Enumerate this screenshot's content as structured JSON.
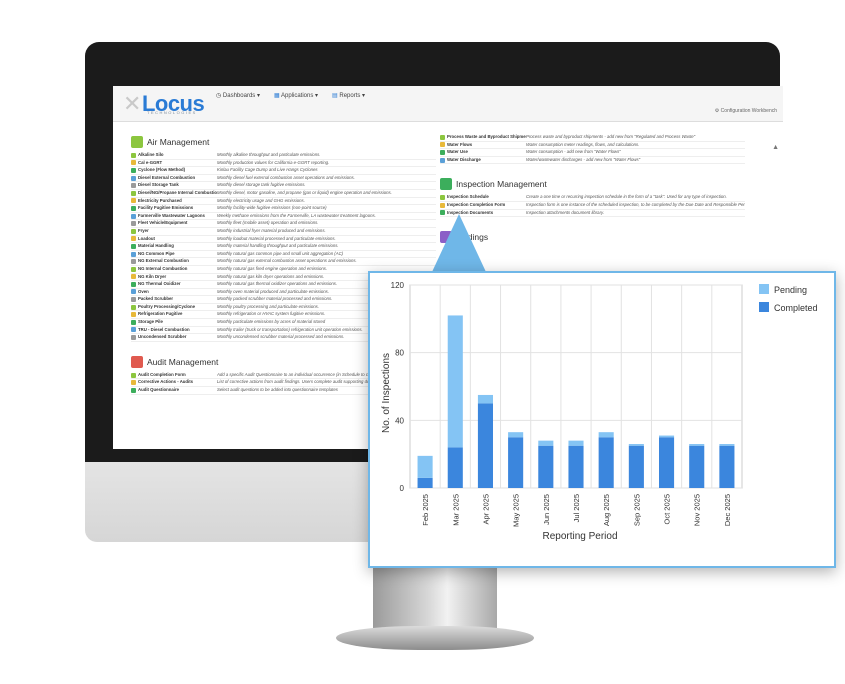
{
  "header": {
    "logo": "Locus",
    "logo_sub": "TECHNOLOGIES",
    "nav": [
      "Dashboards",
      "Applications",
      "Reports"
    ],
    "config": "Configuration Workbench"
  },
  "colors": {
    "accent": "#2a7bd5",
    "pending": "#84c4f4",
    "completed": "#3b86dd"
  },
  "air": {
    "title": "Air Management",
    "items": [
      {
        "name": "Alkaline Silo",
        "desc": "Monthly alkaline throughput and particulate emissions."
      },
      {
        "name": "Cal e-GGRT",
        "desc": "Monthly production values for California e-GGRT reporting."
      },
      {
        "name": "Cyclone (Flow Method)",
        "desc": "Kinlau Facility Cage Dump and Live Hangs Cyclones"
      },
      {
        "name": "Diesel External Combustion",
        "desc": "Monthly diesel fuel external combustion asset operations and emissions."
      },
      {
        "name": "Diesel Storage Tank",
        "desc": "Monthly diesel storage tank fugitive emissions."
      },
      {
        "name": "Diesel/NG/Propane Internal Combustion",
        "desc": "Monthly diesel, motor gasoline, and propane (gas or liquid) engine operation and emissions."
      },
      {
        "name": "Electricity Purchased",
        "desc": "Monthly electricity usage and GHG emissions."
      },
      {
        "name": "Facility Fugitive Emissions",
        "desc": "Monthly facility-wide fugitive emissions (non-point source)"
      },
      {
        "name": "Farmerville Wastewater Lagoons",
        "desc": "Weekly methane emissions from the Farmerville, LA wastewater treatment lagoons."
      },
      {
        "name": "Fleet Vehicle/Equipment",
        "desc": "Monthly fleet (mobile asset) operation and emissions."
      },
      {
        "name": "Fryer",
        "desc": "Monthly industrial fryer material produced and emissions."
      },
      {
        "name": "Loadout",
        "desc": "Monthly loadout material processed and particulate emissions."
      },
      {
        "name": "Material Handling",
        "desc": "Monthly material handling throughput and particulate emissions."
      },
      {
        "name": "NG Common Pipe",
        "desc": "Monthly natural gas common pipe and small unit aggregation (AC)"
      },
      {
        "name": "NG External Combustion",
        "desc": "Monthly natural gas external combustion asset operations and emissions."
      },
      {
        "name": "NG Internal Combustion",
        "desc": "Monthly natural gas fired engine operation and emissions."
      },
      {
        "name": "NG Kiln Dryer",
        "desc": "Monthly natural gas kiln dryer operations and emissions."
      },
      {
        "name": "NG Thermal Oxidizer",
        "desc": "Monthly natural gas thermal oxidizer operations and emissions."
      },
      {
        "name": "Oven",
        "desc": "Monthly oven material produced and particulate emissions."
      },
      {
        "name": "Packed Scrubber",
        "desc": "Monthly packed scrubber material processed and emissions."
      },
      {
        "name": "Poultry Processing/Cyclone",
        "desc": "Monthly poultry processing and particulate emissions."
      },
      {
        "name": "Refrigeration Fugitive",
        "desc": "Monthly refrigeration or HVAC system fugitive emissions."
      },
      {
        "name": "Storage Pile",
        "desc": "Monthly particulate emissions by acres of material stored"
      },
      {
        "name": "TRU - Diesel Combustion",
        "desc": "Monthly trailer (truck or transportation) refrigeration unit operation emissions."
      },
      {
        "name": "Uncondensed Scrubber",
        "desc": "Monthly uncondensed scrubber material processed and emissions."
      }
    ]
  },
  "audit": {
    "title": "Audit Management",
    "items": [
      {
        "name": "Audit Completion Form",
        "desc": "Add a specific Audit Questionnaire to an individual occurrence (in Schedule to conduct an Audit."
      },
      {
        "name": "Corrective Actions - Audits",
        "desc": "List of corrective actions from audit findings. Users complete audit supporting documentation in this entity."
      },
      {
        "name": "Audit Questionnaire",
        "desc": "Select audit questions to be added into questionnaire templates"
      }
    ]
  },
  "water": {
    "items": [
      {
        "name": "Process Waste and Byproduct Shipments",
        "desc": "Process waste and byproduct shipments - add new from \"Regulated and Process Waste\""
      },
      {
        "name": "Water Flows",
        "desc": "Water consumption meter readings, flows, and calculations."
      },
      {
        "name": "Water Use",
        "desc": "Water consumption - add new from \"Water Flows\""
      },
      {
        "name": "Water Discharge",
        "desc": "Water/wastewater discharges - add new from \"Water Flows\""
      }
    ]
  },
  "inspection": {
    "title": "Inspection Management",
    "items": [
      {
        "name": "Inspection Schedule",
        "desc": "Create a one time or recurring inspection schedule in the form of a \"task\". Used for any type of inspection."
      },
      {
        "name": "Inspection Completion Form",
        "desc": "Inspection form is one instance of the scheduled inspection, to be completed by the Due Date and Responsible Person."
      },
      {
        "name": "Inspection Documents",
        "desc": "Inspection attachments document library."
      }
    ]
  },
  "findings": {
    "title": "Findings"
  },
  "chart_data": {
    "type": "bar",
    "stacked": true,
    "categories": [
      "Feb 2025",
      "Mar 2025",
      "Apr 2025",
      "May 2025",
      "Jun 2025",
      "Jul 2025",
      "Aug 2025",
      "Sep 2025",
      "Oct 2025",
      "Nov 2025",
      "Dec 2025"
    ],
    "series": [
      {
        "name": "Completed",
        "values": [
          6,
          24,
          50,
          30,
          25,
          25,
          30,
          25,
          30,
          25,
          25
        ]
      },
      {
        "name": "Pending",
        "values": [
          13,
          78,
          5,
          3,
          3,
          3,
          3,
          1,
          1,
          1,
          1
        ]
      }
    ],
    "xlabel": "Reporting Period",
    "ylabel": "No. of Inspections",
    "ylim": [
      0,
      120
    ],
    "yticks": [
      0,
      40,
      80,
      120
    ],
    "legend": "right",
    "grid": true
  }
}
